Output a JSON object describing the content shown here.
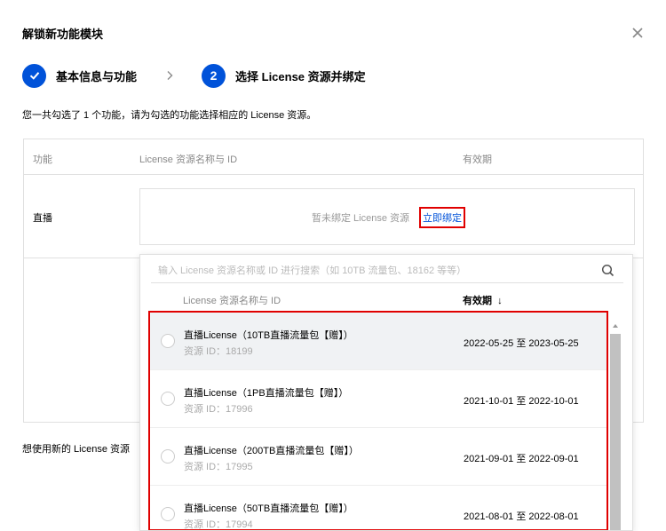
{
  "dialog": {
    "title": "解锁新功能模块"
  },
  "steps": [
    {
      "label": "基本信息与功能",
      "state": "done"
    },
    {
      "number": "2",
      "label": "选择 License 资源并绑定",
      "state": "current"
    }
  ],
  "hint": "您一共勾选了 1 个功能，请为勾选的功能选择相应的 License 资源。",
  "table": {
    "headers": [
      "功能",
      "License 资源名称与 ID",
      "有效期"
    ],
    "rows": [
      {
        "feature": "直播",
        "unbound_text": "暂未绑定 License 资源",
        "bind_link": "立即绑定"
      }
    ]
  },
  "footer_hint": "想使用新的 License 资源",
  "dropdown": {
    "search_placeholder": "输入 License 资源名称或 ID 进行搜索（如 10TB 流量包、18162 等等）",
    "col_name": "License 资源名称与 ID",
    "col_validity": "有效期",
    "sort_arrow": "↓",
    "items": [
      {
        "name": "直播License（10TB直播流量包【赠】）",
        "id": "资源 ID：18199",
        "validity": "2022-05-25 至 2023-05-25"
      },
      {
        "name": "直播License（1PB直播流量包【赠】）",
        "id": "资源 ID：17996",
        "validity": "2021-10-01 至 2022-10-01"
      },
      {
        "name": "直播License（200TB直播流量包【赠】）",
        "id": "资源 ID：17995",
        "validity": "2021-09-01 至 2022-09-01"
      },
      {
        "name": "直播License（50TB直播流量包【赠】）",
        "id": "资源 ID：17994",
        "validity": "2021-08-01 至 2022-08-01"
      }
    ]
  },
  "colors": {
    "primary": "#0052d9",
    "highlight": "#e00000"
  }
}
